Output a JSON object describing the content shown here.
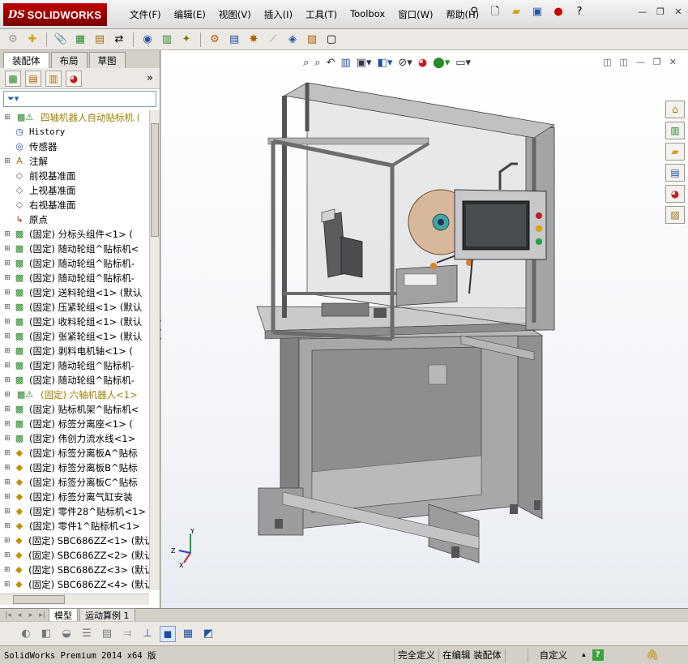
{
  "app": {
    "logo_ds": "DS",
    "logo_name": "SOLIDWORKS"
  },
  "menu": [
    "文件(F)",
    "编辑(E)",
    "视图(V)",
    "插入(I)",
    "工具(T)",
    "Toolbox",
    "窗口(W)",
    "帮助(H)"
  ],
  "panel": {
    "tabs": [
      "装配体",
      "布局",
      "草图"
    ],
    "tree": [
      {
        "label": "四轴机器人自动贴标机  (",
        "icon": "assembly-warning-icon",
        "type": "top"
      },
      {
        "label": "History",
        "icon": "history-icon",
        "type": "mono"
      },
      {
        "label": "传感器",
        "icon": "sensor-icon",
        "type": ""
      },
      {
        "label": "注解",
        "icon": "annotation-icon",
        "type": "exp"
      },
      {
        "label": "前视基准面",
        "icon": "plane-icon",
        "type": ""
      },
      {
        "label": "上视基准面",
        "icon": "plane-icon",
        "type": ""
      },
      {
        "label": "右视基准面",
        "icon": "plane-icon",
        "type": ""
      },
      {
        "label": "原点",
        "icon": "origin-icon",
        "type": ""
      },
      {
        "label": "(固定) 分标头组件<1> (",
        "icon": "subassembly-icon",
        "type": "exp"
      },
      {
        "label": "(固定) 随动轮组^贴标机<",
        "icon": "subassembly-icon",
        "type": "exp"
      },
      {
        "label": "(固定) 随动轮组^贴标机-",
        "icon": "subassembly-icon",
        "type": "exp"
      },
      {
        "label": "(固定) 随动轮组^贴标机-",
        "icon": "subassembly-icon",
        "type": "exp"
      },
      {
        "label": "(固定) 送料轮组<1> (默认",
        "icon": "subassembly-icon",
        "type": "exp"
      },
      {
        "label": "(固定) 压紧轮组<1> (默认",
        "icon": "subassembly-icon",
        "type": "exp"
      },
      {
        "label": "(固定) 收料轮组<1> (默认",
        "icon": "subassembly-icon",
        "type": "exp"
      },
      {
        "label": "(固定) 张紧轮组<1> (默认",
        "icon": "subassembly-icon",
        "type": "exp"
      },
      {
        "label": "(固定) 剥料电机轴<1> (",
        "icon": "subassembly-icon",
        "type": "exp"
      },
      {
        "label": "(固定) 随动轮组^贴标机-",
        "icon": "subassembly-icon",
        "type": "exp"
      },
      {
        "label": "(固定) 随动轮组^贴标机-",
        "icon": "subassembly-icon",
        "type": "exp"
      },
      {
        "label": "(固定) 六轴机器人<1>",
        "icon": "subassembly-warning-icon",
        "type": "warn"
      },
      {
        "label": "(固定) 贴标机架^贴标机<",
        "icon": "subassembly-icon",
        "type": "exp"
      },
      {
        "label": "(固定) 标签分离座<1> (",
        "icon": "subassembly-icon",
        "type": "exp"
      },
      {
        "label": "(固定) 伟创力流水线<1>",
        "icon": "subassembly-icon",
        "type": "exp"
      },
      {
        "label": "(固定) 标签分离板A^贴标",
        "icon": "part-icon",
        "type": "exp"
      },
      {
        "label": "(固定) 标签分离板B^贴标",
        "icon": "part-icon",
        "type": "exp"
      },
      {
        "label": "(固定) 标签分离板C^贴标",
        "icon": "part-icon",
        "type": "exp"
      },
      {
        "label": "(固定) 标签分离气缸安装",
        "icon": "part-icon",
        "type": "exp"
      },
      {
        "label": "(固定) 零件28^贴标机<1>",
        "icon": "part-icon",
        "type": "exp"
      },
      {
        "label": "(固定) 零件1^贴标机<1>",
        "icon": "part-icon",
        "type": "exp"
      },
      {
        "label": "(固定) SBC686ZZ<1> (默认",
        "icon": "part-icon",
        "type": "exp"
      },
      {
        "label": "(固定) SBC686ZZ<2> (默认",
        "icon": "part-icon",
        "type": "exp"
      },
      {
        "label": "(固定) SBC686ZZ<3> (默认",
        "icon": "part-icon",
        "type": "exp"
      },
      {
        "label": "(固定) SBC686ZZ<4> (默认",
        "icon": "part-icon",
        "type": "exp"
      }
    ]
  },
  "bottom_tabs": [
    "模型",
    "运动算例 1"
  ],
  "status": {
    "app": "SolidWorks Premium 2014 x64 版",
    "defined": "完全定义",
    "editing": "在编辑 装配体",
    "custom": "自定义",
    "help": "?"
  },
  "triad": {
    "y": "Y",
    "x": "X",
    "z": "Z"
  },
  "colors": {
    "logo": "#c00000",
    "viewport_top": "#ffffff",
    "frame": "#a9aaac"
  }
}
